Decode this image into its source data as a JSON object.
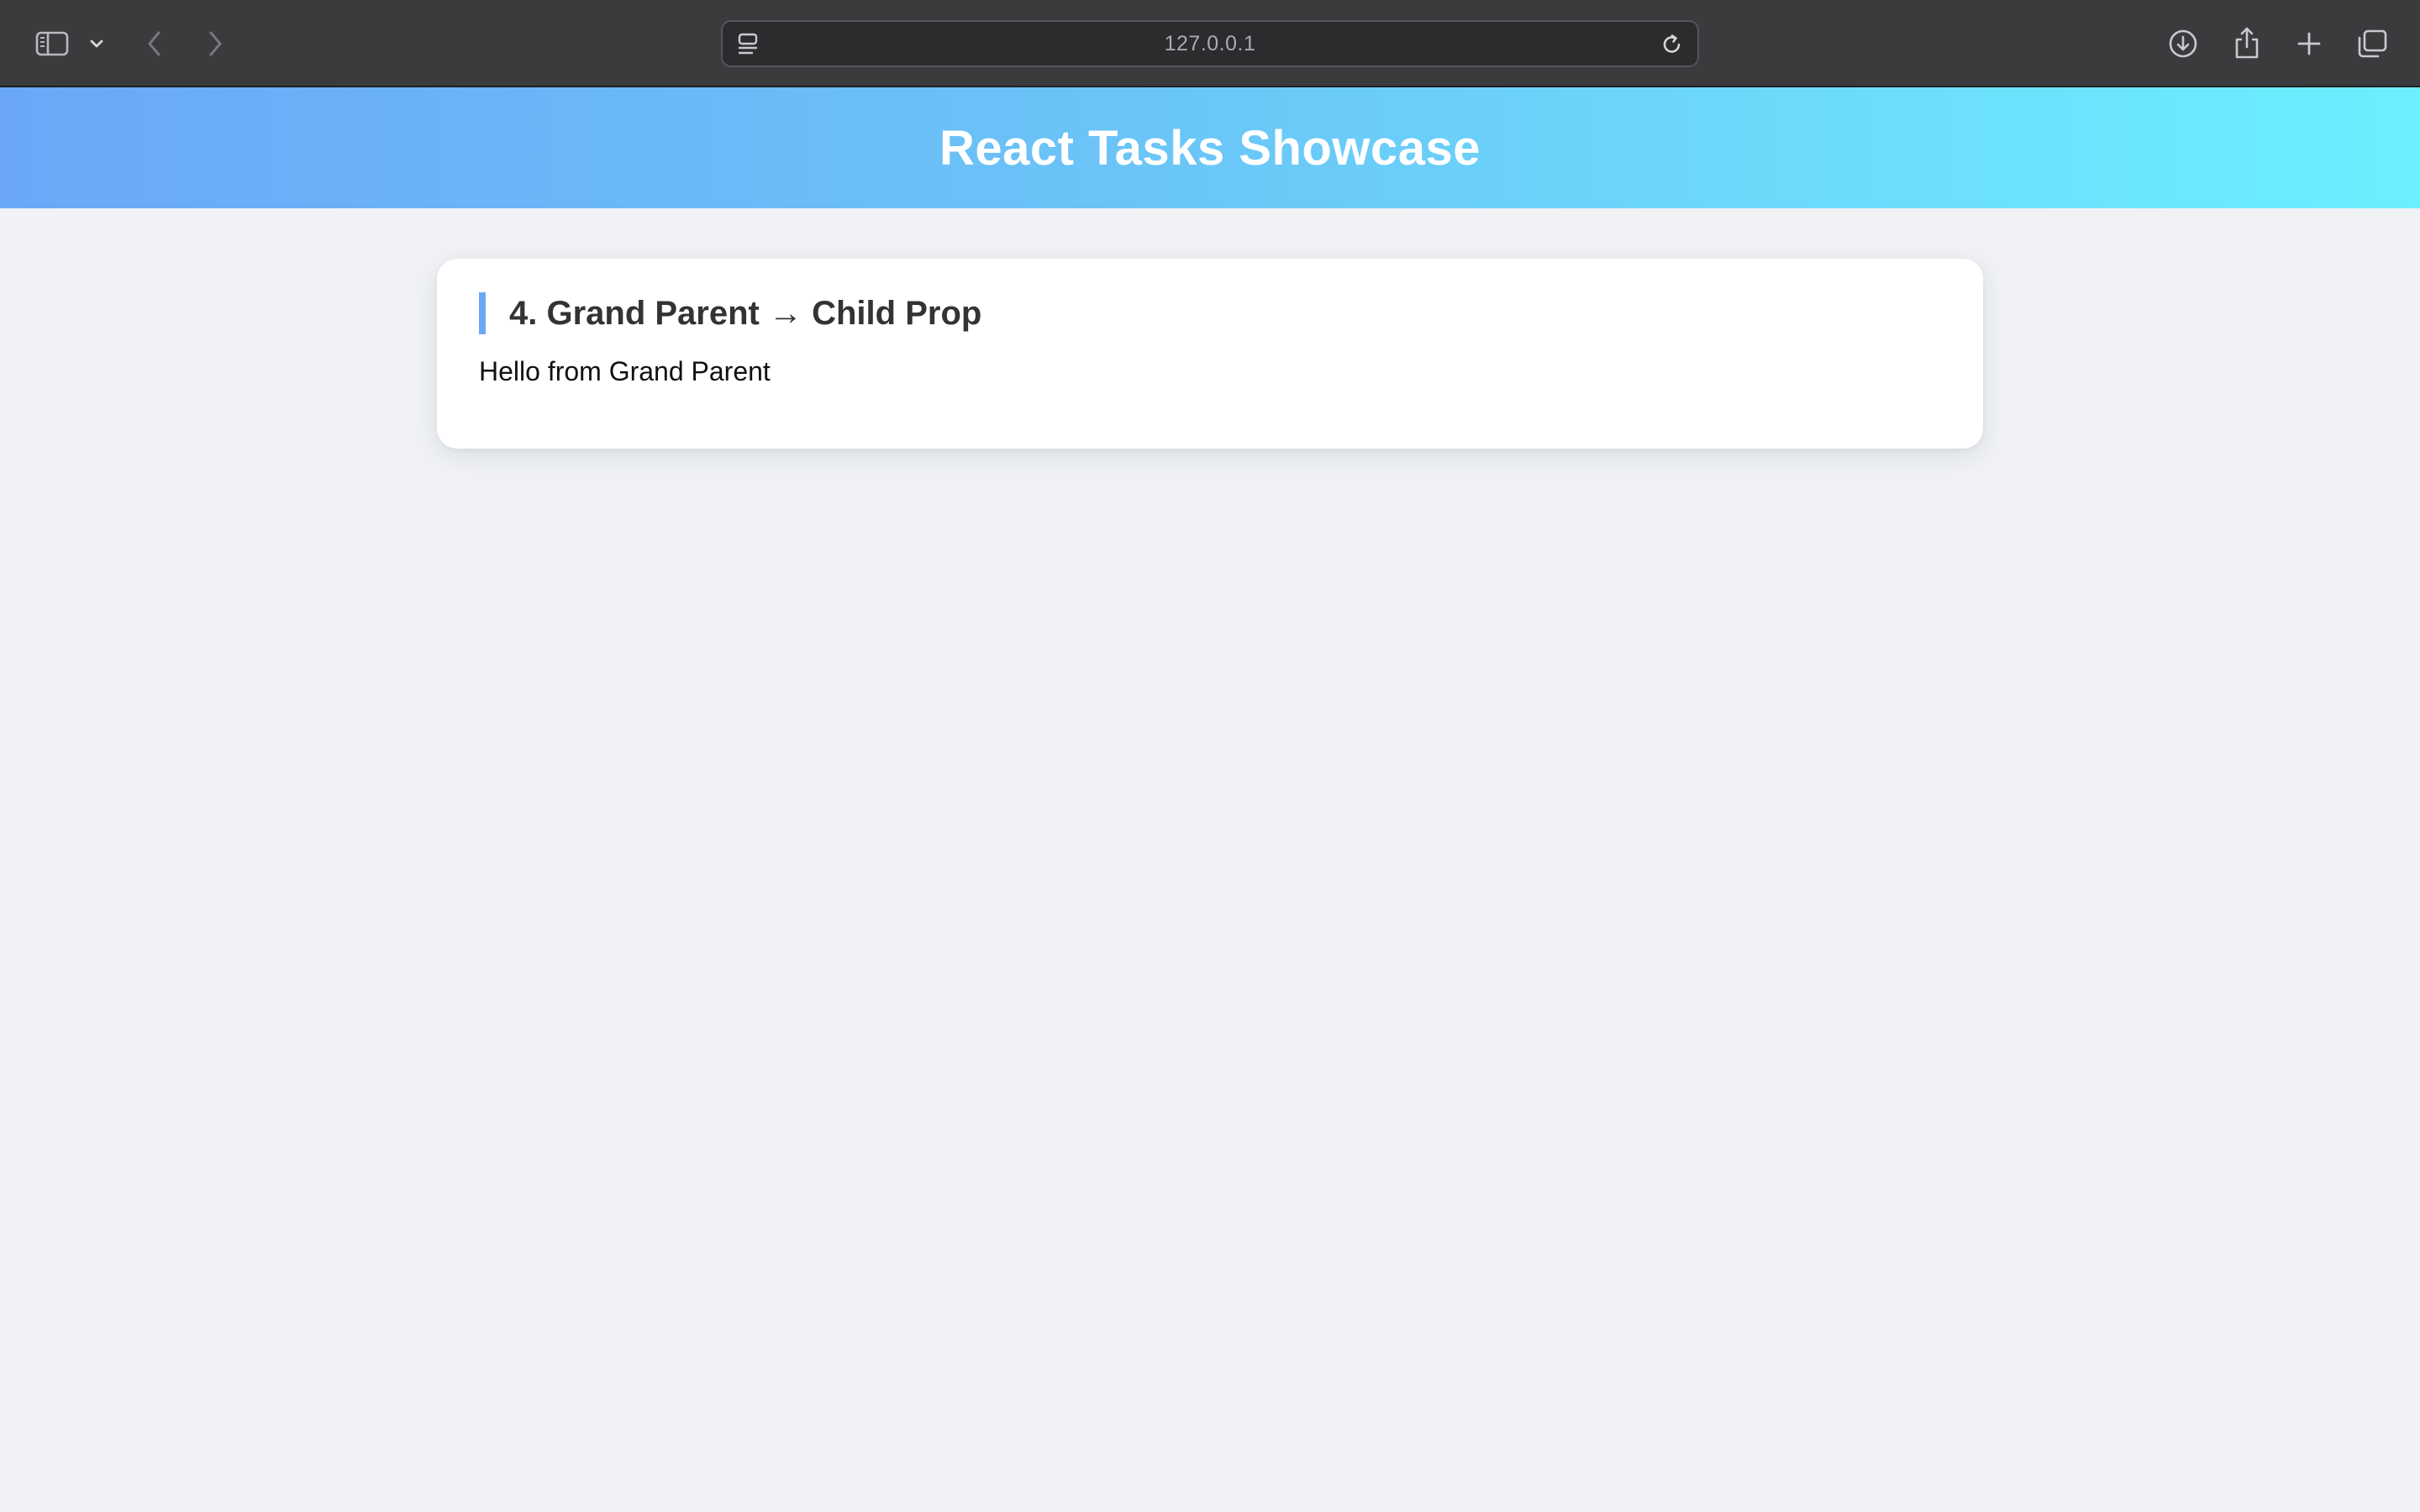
{
  "browser": {
    "url": "127.0.0.1",
    "icons": {
      "sidebar": "sidebar-icon",
      "sidebar_menu": "chevron-down-icon",
      "back": "chevron-left-icon",
      "forward": "chevron-right-icon",
      "page_menu": "page-menu-icon",
      "reload": "reload-icon",
      "downloads": "download-icon",
      "share": "share-icon",
      "new_tab": "plus-icon",
      "tab_overview": "tabs-icon"
    }
  },
  "page": {
    "header_title": "React Tasks Showcase",
    "cards": [
      {
        "title": "4. Grand Parent → Child Prop",
        "text": "Hello from Grand Parent"
      }
    ]
  },
  "colors": {
    "toolbar_bg": "#3a3b3d",
    "header_gradient_start": "#6aa8f7",
    "header_gradient_end": "#6cefff",
    "page_bg": "#f0f2f5",
    "card_accent": "#6aa8f7"
  }
}
